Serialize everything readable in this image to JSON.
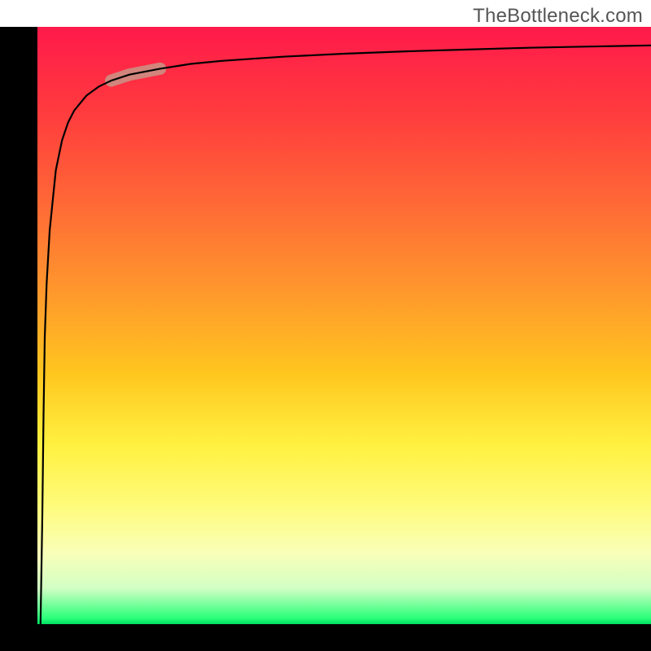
{
  "watermark": "TheBottleneck.com",
  "colors": {
    "gradient_top": "#ff1a4b",
    "gradient_mid1": "#ff9a2c",
    "gradient_mid2": "#fff140",
    "gradient_bottom": "#00e060",
    "axis": "#000000",
    "curve": "#000000",
    "highlight": "#cf8a7f"
  },
  "chart_data": {
    "type": "line",
    "title": "",
    "xlabel": "",
    "ylabel": "",
    "xlim": [
      0,
      100
    ],
    "ylim": [
      0,
      100
    ],
    "series": [
      {
        "name": "curve",
        "x": [
          0.5,
          0.8,
          1.0,
          1.2,
          1.5,
          2,
          3,
          4,
          5,
          6,
          8,
          10,
          12,
          15,
          20,
          25,
          30,
          40,
          50,
          60,
          70,
          80,
          90,
          100
        ],
        "y": [
          0,
          18,
          35,
          48,
          57,
          66,
          76,
          81,
          84,
          86,
          88.5,
          90,
          91,
          92,
          93,
          93.8,
          94.3,
          95,
          95.5,
          95.9,
          96.2,
          96.5,
          96.7,
          96.9
        ]
      }
    ],
    "annotations": [
      {
        "name": "highlight-segment",
        "x_range": [
          12,
          20
        ],
        "y_range": [
          91,
          93
        ],
        "color": "#cf8a7f"
      }
    ]
  }
}
